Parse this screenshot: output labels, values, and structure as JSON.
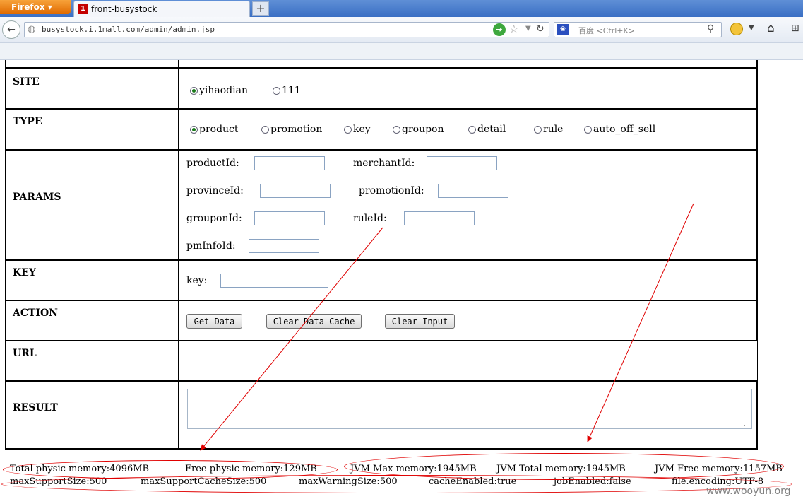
{
  "browser": {
    "app_button": "Firefox",
    "tab_title": "front-busystock",
    "new_tab": "+",
    "url": "busystock.i.1mall.com/admin/admin.jsp",
    "search_placeholder": "百度 <Ctrl+K>"
  },
  "form": {
    "site": {
      "label": "SITE",
      "options": [
        {
          "label": "yihaodian",
          "checked": true
        },
        {
          "label": "111",
          "checked": false
        }
      ]
    },
    "type": {
      "label": "TYPE",
      "options": [
        {
          "label": "product",
          "checked": true
        },
        {
          "label": "promotion",
          "checked": false
        },
        {
          "label": "key",
          "checked": false
        },
        {
          "label": "groupon",
          "checked": false
        },
        {
          "label": "detail",
          "checked": false
        },
        {
          "label": "rule",
          "checked": false
        },
        {
          "label": "auto_off_sell",
          "checked": false
        }
      ]
    },
    "params": {
      "label": "PARAMS",
      "fields": [
        {
          "label": "productId:",
          "value": ""
        },
        {
          "label": "merchantId:",
          "value": ""
        },
        {
          "label": "provinceId:",
          "value": ""
        },
        {
          "label": "promotionId:",
          "value": ""
        },
        {
          "label": "grouponId:",
          "value": ""
        },
        {
          "label": "ruleId:",
          "value": ""
        },
        {
          "label": "pmInfoId:",
          "value": ""
        }
      ]
    },
    "key": {
      "label": "KEY",
      "field_label": "key:",
      "value": ""
    },
    "action": {
      "label": "ACTION",
      "buttons": [
        "Get Data",
        "Clear Data Cache",
        "Clear Input"
      ]
    },
    "url": {
      "label": "URL",
      "value": ""
    },
    "result": {
      "label": "RESULT",
      "value": ""
    }
  },
  "status": {
    "line1": [
      "Total physic memory:4096MB",
      "Free physic memory:129MB",
      "JVM Max memory:1945MB",
      "JVM Total memory:1945MB",
      "JVM Free memory:1157MB"
    ],
    "line2": [
      "maxSupportSize:500",
      "maxSupportCacheSize:500",
      "maxWarningSize:500",
      "cacheEnabled:true",
      "jobEnabled:false",
      "file.encoding:UTF-8"
    ]
  },
  "annotation_color": "#e00000",
  "watermark": "www.wooyun.org"
}
